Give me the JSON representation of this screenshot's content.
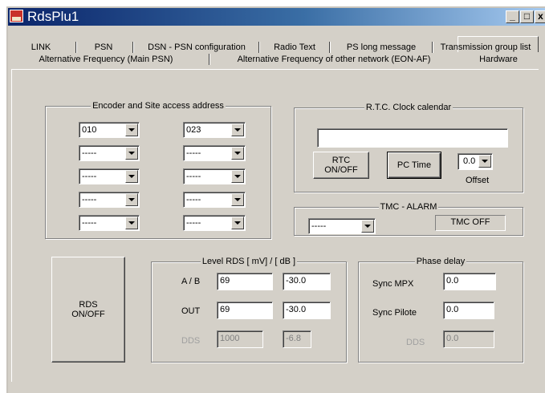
{
  "window": {
    "title": "RdsPlu1"
  },
  "titlebar_buttons": {
    "minimize": "_",
    "maximize": "□",
    "close": "x"
  },
  "tabs_row1": [
    "LINK",
    "PSN",
    "DSN - PSN configuration",
    "Radio Text",
    "PS long message",
    "Transmission group list"
  ],
  "tabs_row2": [
    "Alternative Frequency (Main PSN)",
    "Alternative Frequency of other network (EON-AF)",
    "Hardware"
  ],
  "active_tab": "Hardware",
  "encoder": {
    "title": "Encoder and Site access address",
    "left_values": [
      "010",
      "-----",
      "-----",
      "-----",
      "-----"
    ],
    "right_values": [
      "023",
      "-----",
      "-----",
      "-----",
      "-----"
    ]
  },
  "rtc": {
    "title": "R.T.C.  Clock calendar",
    "clock_value": "",
    "rtc_button_line1": "RTC",
    "rtc_button_line2": "ON/OFF",
    "pc_time_button": "PC Time",
    "offset_value": "0.0",
    "offset_label": "Offset"
  },
  "tmc": {
    "title": "TMC - ALARM",
    "select_value": "-----",
    "status": "TMC OFF"
  },
  "rds_button": {
    "line1": "RDS",
    "line2": "ON/OFF"
  },
  "level": {
    "title": "Level  RDS  [ mV] / [ dB ]",
    "rows": [
      {
        "label": "A / B",
        "mv": "69",
        "db": "-30.0"
      },
      {
        "label": "OUT",
        "mv": "69",
        "db": "-30.0"
      },
      {
        "label": "DDS",
        "mv": "1000",
        "db": "-6.8"
      }
    ]
  },
  "phase": {
    "title": "Phase delay",
    "rows": [
      {
        "label": "Sync MPX",
        "value": "0.0"
      },
      {
        "label": "Sync Pilote",
        "value": "0.0"
      },
      {
        "label": "DDS",
        "value": "0.0"
      }
    ]
  }
}
